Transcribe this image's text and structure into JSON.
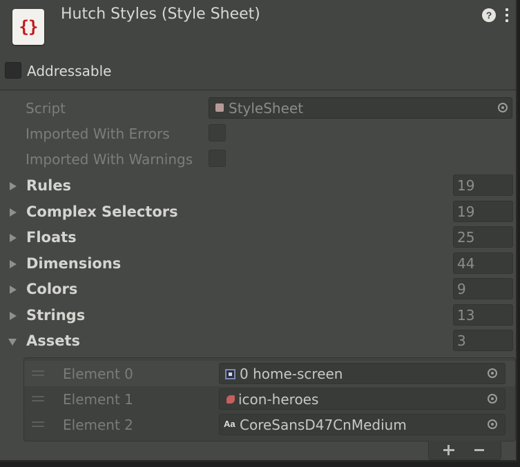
{
  "header": {
    "asset_icon_glyph": "{}",
    "title": "Hutch Styles (Style Sheet)",
    "help_icon": "?",
    "addressable_label": "Addressable"
  },
  "props": {
    "script_label": "Script",
    "script_value": "StyleSheet",
    "errors_label": "Imported With Errors",
    "warnings_label": "Imported With Warnings"
  },
  "foldouts": [
    {
      "label": "Rules",
      "count": "19",
      "expanded": false
    },
    {
      "label": "Complex Selectors",
      "count": "19",
      "expanded": false
    },
    {
      "label": "Floats",
      "count": "25",
      "expanded": false
    },
    {
      "label": "Dimensions",
      "count": "44",
      "expanded": false
    },
    {
      "label": "Colors",
      "count": "9",
      "expanded": false
    },
    {
      "label": "Strings",
      "count": "13",
      "expanded": false
    },
    {
      "label": "Assets",
      "count": "3",
      "expanded": true
    }
  ],
  "assets": [
    {
      "label": "Element 0",
      "value": "0 home-screen",
      "icon": "visual-tree-asset-icon"
    },
    {
      "label": "Element 1",
      "value": "icon-heroes",
      "icon": "sprite-icon"
    },
    {
      "label": "Element 2",
      "value": "CoreSansD47CnMedium",
      "icon": "font-asset-icon",
      "icon_glyph": "Aa"
    }
  ],
  "colors": {
    "panel_bg": "#464845",
    "field_bg": "#393b38",
    "asset_icon_accent": "#c0171b"
  }
}
